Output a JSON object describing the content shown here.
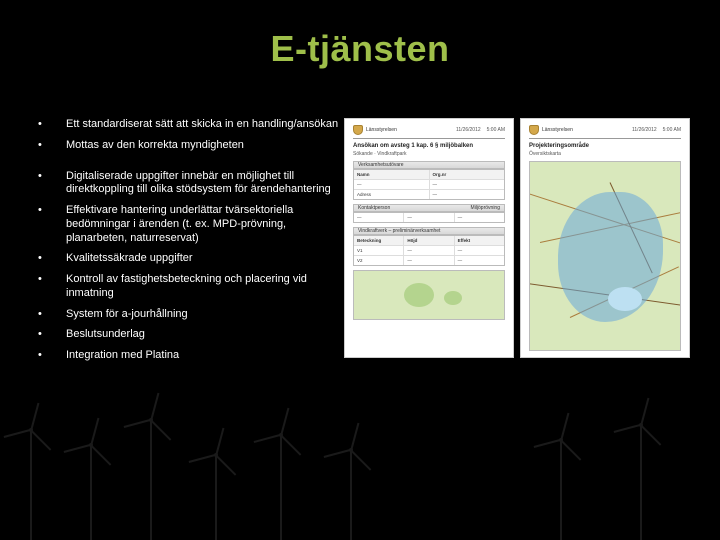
{
  "title": "E-tjänsten",
  "bullets": [
    "Ett standardiserat sätt att skicka in en handling/ansökan",
    "Mottas av den korrekta myndigheten",
    "",
    "Digitaliserade uppgifter innebär en möjlighet till direktkoppling till olika stödsystem för ärendehantering",
    "Effektivare hantering underlättar  tvärsektoriella bedömningar i ärenden (t. ex. MPD-prövning, planarbeten, naturreservat)",
    "Kvalitetssäkrade uppgifter",
    "Kontroll av fastighetsbeteckning och placering vid inmatning",
    "System för a-jourhållning",
    "Beslutsunderlag",
    "Integration med Platina"
  ],
  "doc1": {
    "crest": "Länsstyrelsen",
    "dates": [
      "11/26/2012",
      "5:00 AM"
    ],
    "head1": "Ansökan om avsteg 1 kap. 6 § miljöbalken",
    "head2": "Sökande · Vindkraftpark",
    "sec1": "Verksamhetsutövare",
    "tbl1": {
      "h": [
        "Namn",
        "Org.nr"
      ],
      "r1": [
        "—",
        "—"
      ],
      "r2": [
        "Adress",
        "—"
      ]
    },
    "sec2a": "Kontaktperson",
    "sec2b": "Miljöprövning",
    "tbl2": {
      "h": [
        "",
        "",
        ""
      ],
      "r1": [
        "—",
        "—",
        "—"
      ]
    },
    "sec3": "Vindkraftverk – preliminärverksamhet",
    "tbl3": {
      "h": [
        "Beteckning",
        "Höjd",
        "Effekt"
      ],
      "r1": [
        "V1",
        "—",
        "—"
      ],
      "r2": [
        "V2",
        "—",
        "—"
      ]
    },
    "minimap_label": ""
  },
  "doc2": {
    "crest": "Länsstyrelsen",
    "dates": [
      "11/26/2012",
      "5:00 AM"
    ],
    "head1": "Projekteringsområde",
    "head2": "Översiktskarta"
  }
}
